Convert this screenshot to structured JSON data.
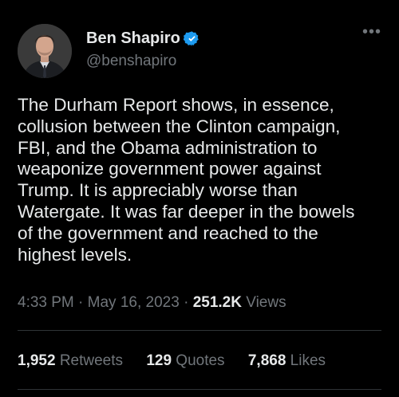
{
  "author": {
    "name": "Ben Shapiro",
    "handle": "@benshapiro",
    "verified_icon": "verified-badge-icon",
    "verified_color": "#1d9bf0"
  },
  "tweet": {
    "text": "The Durham Report shows, in essence,\ncollusion between the Clinton campaign,\nFBI, and the Obama administration to\nweaponize government power against\nTrump. It is appreciably worse than\nWatergate. It was far deeper in the bowels\nof the government and reached to the\nhighest levels.",
    "time": "4:33 PM",
    "sep1": " · ",
    "date": "May 16, 2023",
    "sep2": " · ",
    "views_count": "251.2K",
    "views_label": "Views"
  },
  "stats": {
    "retweets_count": "1,952",
    "retweets_label": "Retweets",
    "quotes_count": "129",
    "quotes_label": "Quotes",
    "likes_count": "7,868",
    "likes_label": "Likes"
  },
  "colors": {
    "background": "#000000",
    "text_primary": "#e7e9ea",
    "text_secondary": "#71767b",
    "divider": "#2f3336"
  },
  "menu": {
    "more_icon": "more-horizontal-icon",
    "more_glyph": "•••"
  }
}
